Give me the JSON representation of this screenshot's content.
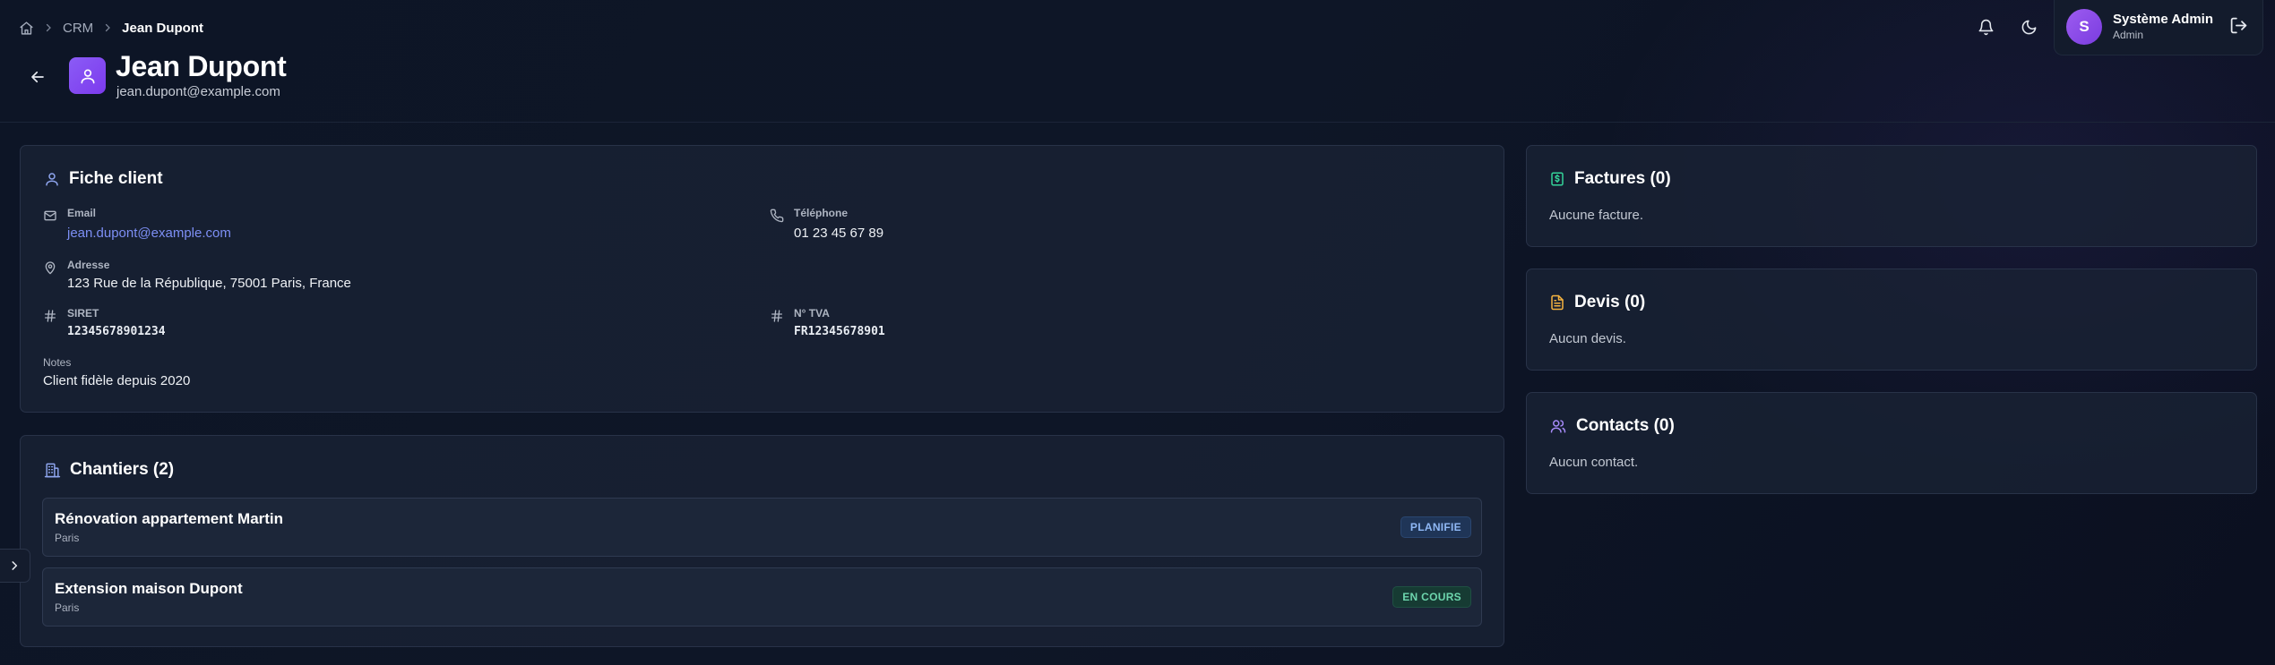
{
  "breadcrumb": {
    "home_icon": "home-icon",
    "items": [
      "CRM",
      "Jean Dupont"
    ]
  },
  "header": {
    "title": "Jean Dupont",
    "subtitle": "jean.dupont@example.com",
    "user": {
      "initial": "S",
      "name": "Système Admin",
      "role": "Admin"
    }
  },
  "client_card": {
    "title": "Fiche client",
    "email_label": "Email",
    "email_value": "jean.dupont@example.com",
    "phone_label": "Téléphone",
    "phone_value": "01 23 45 67 89",
    "address_label": "Adresse",
    "address_value": "123 Rue de la République, 75001 Paris, France",
    "siret_label": "SIRET",
    "siret_value": "12345678901234",
    "tva_label": "N° TVA",
    "tva_value": "FR12345678901",
    "notes_label": "Notes",
    "notes_value": "Client fidèle depuis 2020"
  },
  "sites_card": {
    "title": "Chantiers (2)",
    "items": [
      {
        "name": "Rénovation appartement Martin",
        "city": "Paris",
        "status": "PLANIFIE"
      },
      {
        "name": "Extension maison Dupont",
        "city": "Paris",
        "status": "EN COURS"
      }
    ]
  },
  "invoices_card": {
    "title": "Factures (0)",
    "empty": "Aucune facture."
  },
  "quotes_card": {
    "title": "Devis (0)",
    "empty": "Aucun devis."
  },
  "contacts_card": {
    "title": "Contacts (0)",
    "empty": "Aucun contact."
  },
  "colors": {
    "accent": "#8b5cf6",
    "link": "#7d8ff5",
    "invoice_icon": "#34d399",
    "quote_icon": "#f5b340",
    "contacts_icon": "#a78bfa",
    "client_icon": "#8fa6f0",
    "badge_planned": "#8fb8f5",
    "badge_ongoing": "#6dd6ad"
  }
}
